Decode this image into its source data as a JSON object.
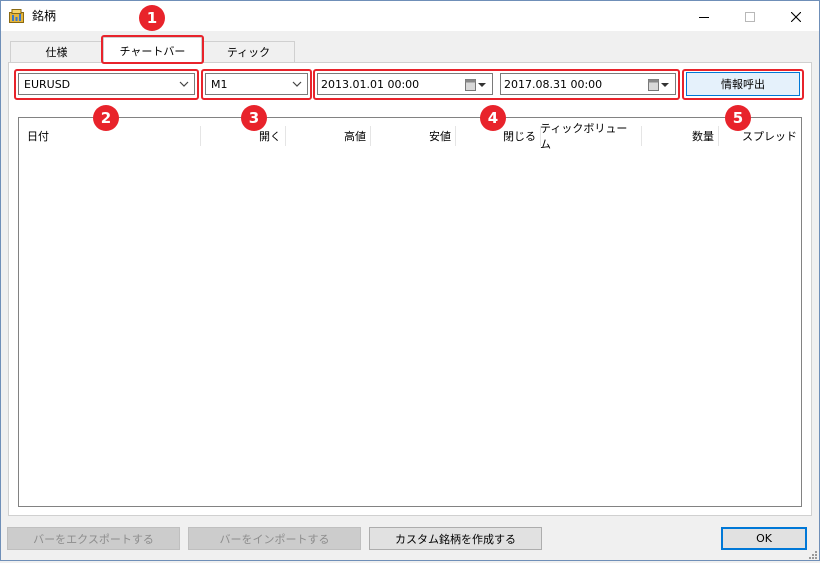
{
  "window": {
    "title": "銘柄",
    "icon": "app-icon",
    "controls": [
      "minimize-icon",
      "maximize-icon",
      "close-icon"
    ]
  },
  "tabs": [
    {
      "label": "仕様",
      "active": false
    },
    {
      "label": "チャートバー",
      "active": true
    },
    {
      "label": "ティック",
      "active": false
    }
  ],
  "toolbar": {
    "symbol_value": "EURUSD",
    "timeframe_value": "M1",
    "date_from": "2013.01.01 00:00",
    "date_to": "2017.08.31 00:00",
    "load_button": "情報呼出"
  },
  "table": {
    "columns": [
      "日付",
      "開く",
      "高値",
      "安値",
      "閉じる",
      "ティックボリューム",
      "数量",
      "スプレッド"
    ],
    "rows": []
  },
  "annotations": {
    "badges": [
      "1",
      "2",
      "3",
      "4",
      "5"
    ],
    "color": "#e8232b"
  },
  "buttons": {
    "export_bars": "バーをエクスポートする",
    "import_bars": "バーをインポートする",
    "create_custom": "カスタム銘柄を作成する",
    "ok": "OK"
  },
  "colors": {
    "accent": "#0078d7",
    "highlight": "#e8232b",
    "window_bg": "#f0f0f0"
  }
}
